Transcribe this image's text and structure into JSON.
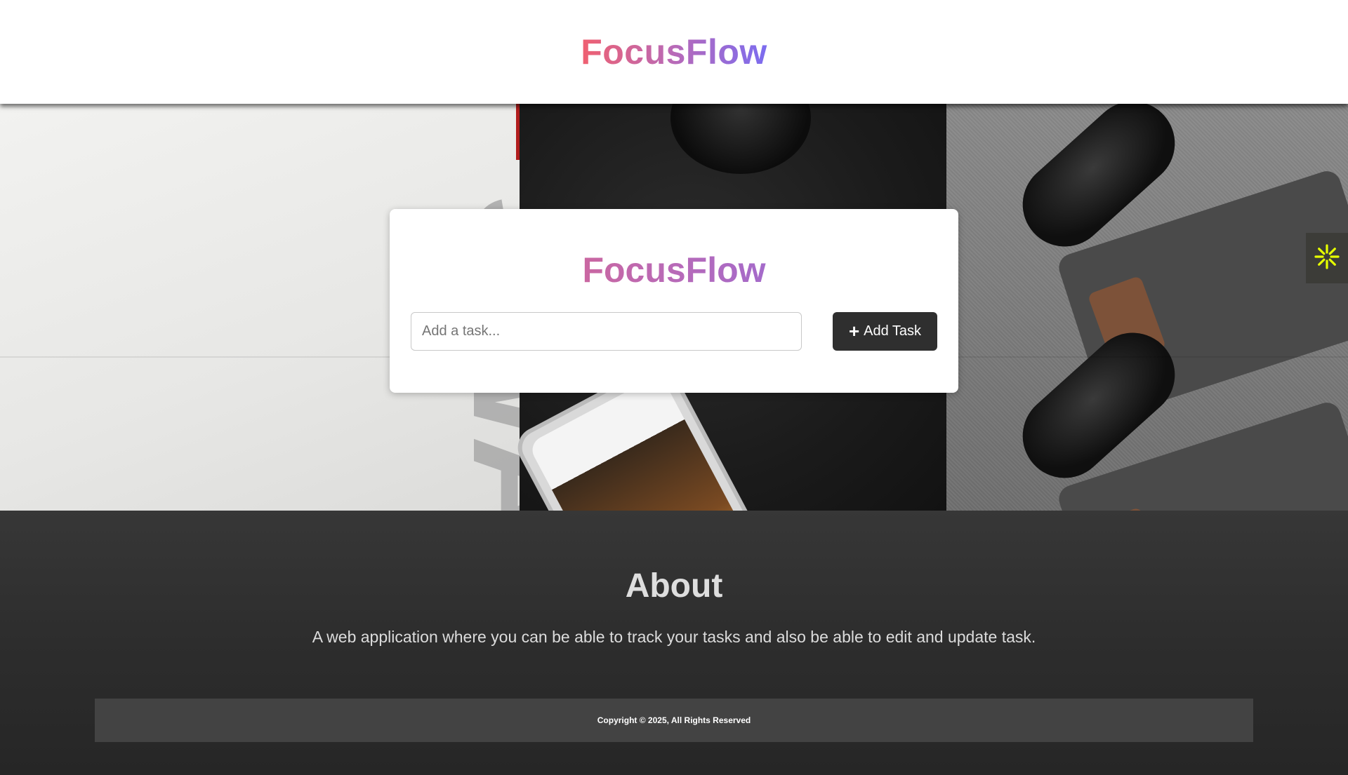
{
  "header": {
    "logo_text": "FocusFlow"
  },
  "hero": {
    "card": {
      "title": "FocusFlow",
      "task_input": {
        "value": "",
        "placeholder": "Add a task..."
      },
      "add_button": {
        "icon": "plus-icon",
        "label": "Add Task"
      }
    },
    "side_widget": {
      "icon": "asterisk-icon",
      "color": "#e6ff00"
    }
  },
  "about": {
    "heading": "About",
    "description": "A web application where you can be able to track your tasks and also be able to edit and update task."
  },
  "footer": {
    "copyright": "Copyright © 2025, All Rights Reserved"
  },
  "colors": {
    "brand_gradient_start": "#f06070",
    "brand_gradient_end": "#7b6cf0",
    "button_bg": "#2f2f2f",
    "about_bg": "#2d2d2d"
  }
}
